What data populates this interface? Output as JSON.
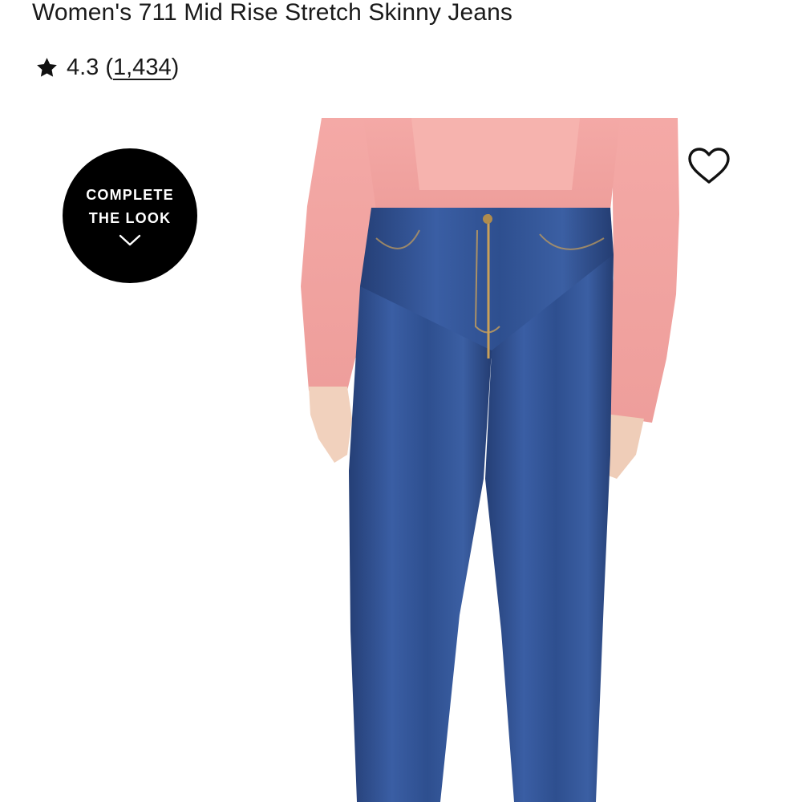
{
  "product": {
    "title": "Women's 711 Mid Rise Stretch Skinny Jeans",
    "rating": {
      "value": "4.3",
      "open_paren": "(",
      "count": "1,434",
      "close_paren": ")",
      "icon": "star-icon"
    },
    "image": {
      "icon": "product-photo",
      "top_color": "#f2a7a4",
      "jeans_color": "#2f4f8f",
      "skin_color": "#f1d1bd"
    }
  },
  "complete_the_look": {
    "line1": "COMPLETE",
    "line2": "THE LOOK",
    "icon": "chevron-down-icon"
  },
  "wishlist": {
    "icon": "heart-icon"
  }
}
